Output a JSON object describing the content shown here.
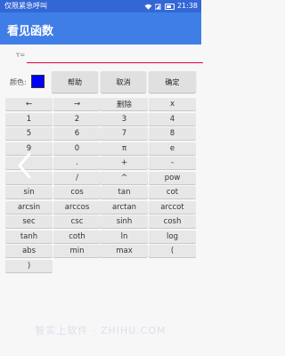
{
  "status_bar": {
    "left_text": "仅限紧急呼叫",
    "time": "21:38",
    "icons": [
      "wifi-icon",
      "sim-signal-icon",
      "battery-icon"
    ]
  },
  "app_bar": {
    "title": "看见函数"
  },
  "input": {
    "label": "Y=",
    "value": "",
    "placeholder": ""
  },
  "color": {
    "label": "颜色:",
    "swatch": "#0000ff"
  },
  "buttons": {
    "help": "帮助",
    "cancel": "取消",
    "confirm": "确定"
  },
  "keypad": [
    [
      "←",
      "→",
      "删除",
      "x"
    ],
    [
      "1",
      "2",
      "3",
      "4"
    ],
    [
      "5",
      "6",
      "7",
      "8"
    ],
    [
      "9",
      "0",
      "π",
      "e"
    ],
    [
      "",
      ".",
      "+",
      "-"
    ],
    [
      "",
      "/",
      "^",
      "pow"
    ],
    [
      "sin",
      "cos",
      "tan",
      "cot"
    ],
    [
      "arcsin",
      "arccos",
      "arctan",
      "arccot"
    ],
    [
      "sec",
      "csc",
      "sinh",
      "cosh"
    ],
    [
      "tanh",
      "coth",
      "ln",
      "log"
    ],
    [
      "abs",
      "min",
      "max",
      "("
    ],
    [
      ")"
    ]
  ],
  "watermark": "智实上软件 · ZHIHU.COM"
}
